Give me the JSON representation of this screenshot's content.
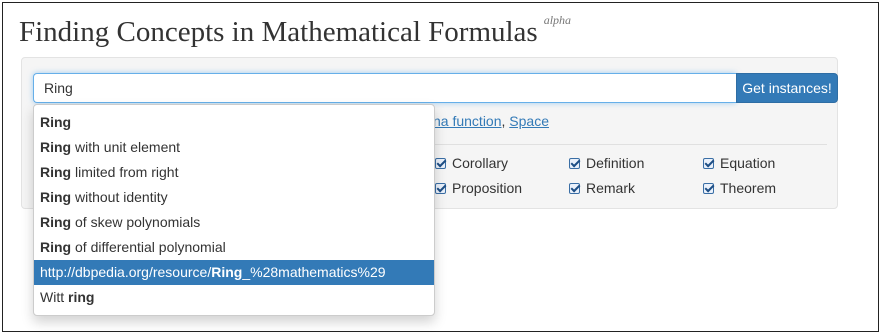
{
  "header": {
    "title": "Finding Concepts in Mathematical Formulas",
    "badge": "alpha"
  },
  "search": {
    "value": "Ring",
    "button_label": "Get instances!"
  },
  "suggestions": {
    "link1": "na function",
    "separator": ", ",
    "link2": "Space"
  },
  "filters": [
    {
      "label": "Corollary",
      "checked": true
    },
    {
      "label": "Definition",
      "checked": true
    },
    {
      "label": "Equation",
      "checked": true
    },
    {
      "label": "Proposition",
      "checked": true
    },
    {
      "label": "Remark",
      "checked": true
    },
    {
      "label": "Theorem",
      "checked": true
    }
  ],
  "dropdown": {
    "items": [
      {
        "bold": "Ring",
        "rest": ""
      },
      {
        "bold": "Ring",
        "rest": " with unit element"
      },
      {
        "bold": "Ring",
        "rest": " limited from right"
      },
      {
        "bold": "Ring",
        "rest": " without identity"
      },
      {
        "bold": "Ring",
        "rest": " of skew polynomials"
      },
      {
        "bold": "Ring",
        "rest": " of differential polynomial"
      },
      {
        "pre": "http://dbpedia.org/resource/",
        "bold": "Ring",
        "rest": "_%28mathematics%29",
        "active": true
      },
      {
        "pre": "Witt ",
        "bold": "ring",
        "rest": ""
      }
    ]
  },
  "colors": {
    "primary": "#337ab7",
    "focus": "#66afe9",
    "panel": "#f5f5f5"
  }
}
